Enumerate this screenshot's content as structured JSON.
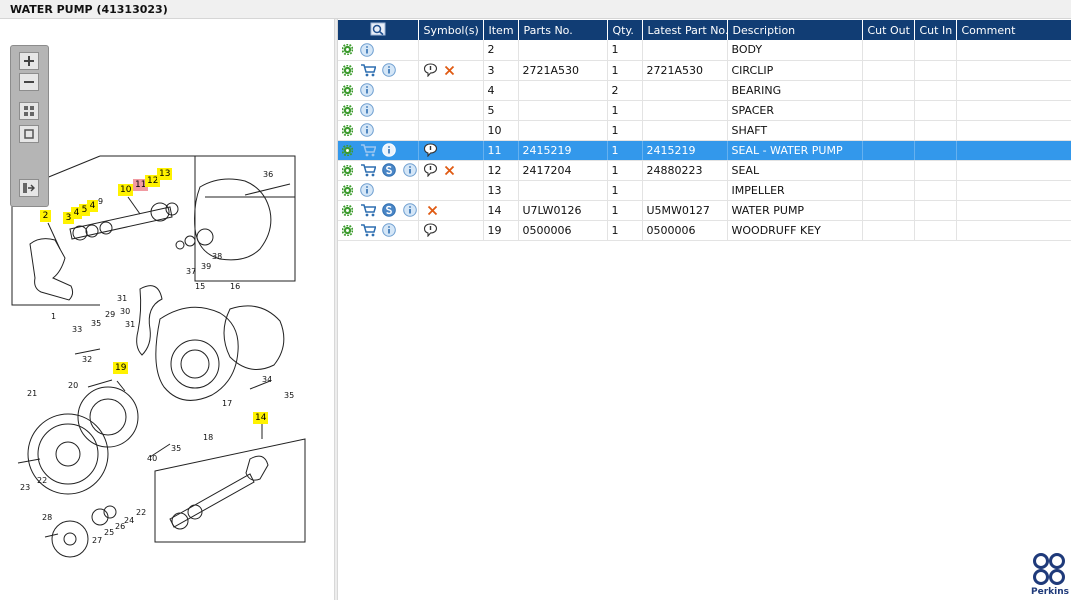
{
  "window": {
    "title": "WATER PUMP (41313023)"
  },
  "table": {
    "headers": {
      "symbols": "Symbol(s)",
      "item": "Item",
      "parts_no": "Parts No.",
      "qty": "Qty.",
      "latest": "Latest Part No.",
      "description": "Description",
      "cut_out": "Cut Out",
      "cut_in": "Cut In",
      "comment": "Comment"
    },
    "rows": [
      {
        "item": "2",
        "parts_no": "",
        "qty": "1",
        "latest": "",
        "description": "BODY"
      },
      {
        "item": "3",
        "parts_no": "2721A530",
        "qty": "1",
        "latest": "2721A530",
        "description": "CIRCLIP"
      },
      {
        "item": "4",
        "parts_no": "",
        "qty": "2",
        "latest": "",
        "description": "BEARING"
      },
      {
        "item": "5",
        "parts_no": "",
        "qty": "1",
        "latest": "",
        "description": "SPACER"
      },
      {
        "item": "10",
        "parts_no": "",
        "qty": "1",
        "latest": "",
        "description": "SHAFT"
      },
      {
        "item": "11",
        "parts_no": "2415219",
        "qty": "1",
        "latest": "2415219",
        "description": "SEAL - WATER PUMP"
      },
      {
        "item": "12",
        "parts_no": "2417204",
        "qty": "1",
        "latest": "24880223",
        "description": "SEAL"
      },
      {
        "item": "13",
        "parts_no": "",
        "qty": "1",
        "latest": "",
        "description": "IMPELLER"
      },
      {
        "item": "14",
        "parts_no": "U7LW0126",
        "qty": "1",
        "latest": "U5MW0127",
        "description": "WATER PUMP"
      },
      {
        "item": "19",
        "parts_no": "0500006",
        "qty": "1",
        "latest": "0500006",
        "description": "WOODRUFF KEY"
      }
    ]
  },
  "diagram": {
    "callouts": [
      "2",
      "3",
      "4",
      "5",
      "4",
      "9",
      "10",
      "11",
      "12",
      "13",
      "19",
      "14"
    ],
    "labels": [
      "36",
      "37",
      "39",
      "38",
      "1",
      "31",
      "30",
      "29",
      "31",
      "15",
      "16",
      "33",
      "35",
      "32",
      "34",
      "21",
      "20",
      "17",
      "35",
      "18",
      "35",
      "40",
      "23",
      "22",
      "22",
      "28",
      "25",
      "26",
      "24",
      "27"
    ]
  },
  "brand": {
    "name": "Perkins",
    "color": "#1f3a7a"
  },
  "colors": {
    "header_bg": "#113d74",
    "selected_row": "#3398eb",
    "callout_yellow": "#fff200",
    "callout_red": "#f19aa1"
  }
}
